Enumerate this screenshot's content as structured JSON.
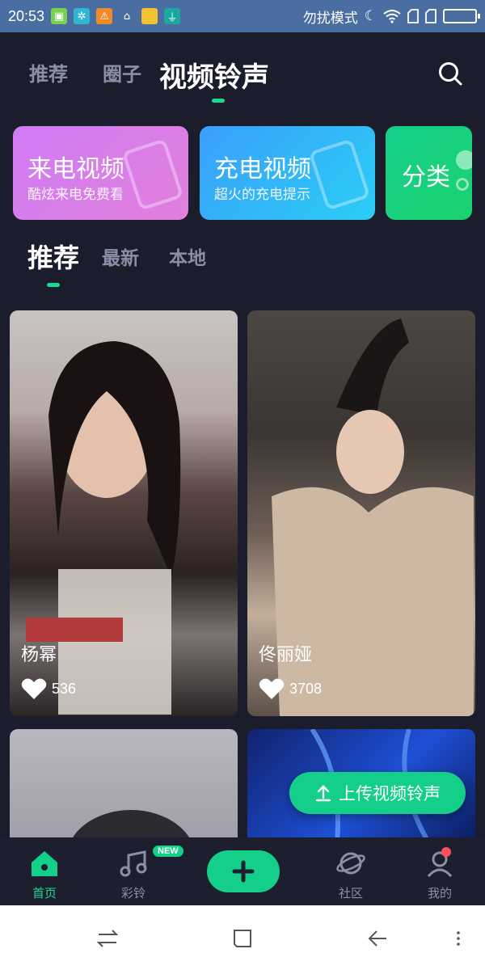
{
  "status_bar": {
    "time": "20:53",
    "dnd_label": "勿扰模式"
  },
  "top_nav": {
    "tabs": [
      {
        "label": "推荐"
      },
      {
        "label": "圈子"
      },
      {
        "label": "视频铃声"
      }
    ],
    "active_index": 2
  },
  "banners": [
    {
      "title": "来电视频",
      "subtitle": "酷炫来电免费看",
      "color_from": "#c77cf7",
      "color_to": "#e67ed8"
    },
    {
      "title": "充电视频",
      "subtitle": "超火的充电提示",
      "color_from": "#39a4fb",
      "color_to": "#2ec9f6"
    },
    {
      "title": "分类",
      "subtitle": "",
      "color_from": "#14cf8a",
      "color_to": "#1cd36f"
    }
  ],
  "sub_tabs": [
    {
      "label": "推荐"
    },
    {
      "label": "最新"
    },
    {
      "label": "本地"
    }
  ],
  "videos": [
    {
      "name": "杨幂",
      "likes": "536"
    },
    {
      "name": "佟丽娅",
      "likes": "3708"
    },
    {
      "name": "",
      "likes": ""
    },
    {
      "name": "",
      "likes": ""
    }
  ],
  "upload_button": {
    "label": "上传视频铃声"
  },
  "bottom_nav": {
    "items": [
      {
        "label": "首页",
        "icon": "home-icon"
      },
      {
        "label": "彩铃",
        "icon": "music-note-icon",
        "badge": "NEW"
      },
      {
        "label": "",
        "icon": "plus-icon"
      },
      {
        "label": "社区",
        "icon": "planet-icon"
      },
      {
        "label": "我的",
        "icon": "user-icon"
      }
    ],
    "active_index": 0
  },
  "colors": {
    "accent": "#14cf8a",
    "background": "#1c1d2c",
    "muted_text": "#8a8fa6",
    "status_bar": "#4b6ea2"
  }
}
